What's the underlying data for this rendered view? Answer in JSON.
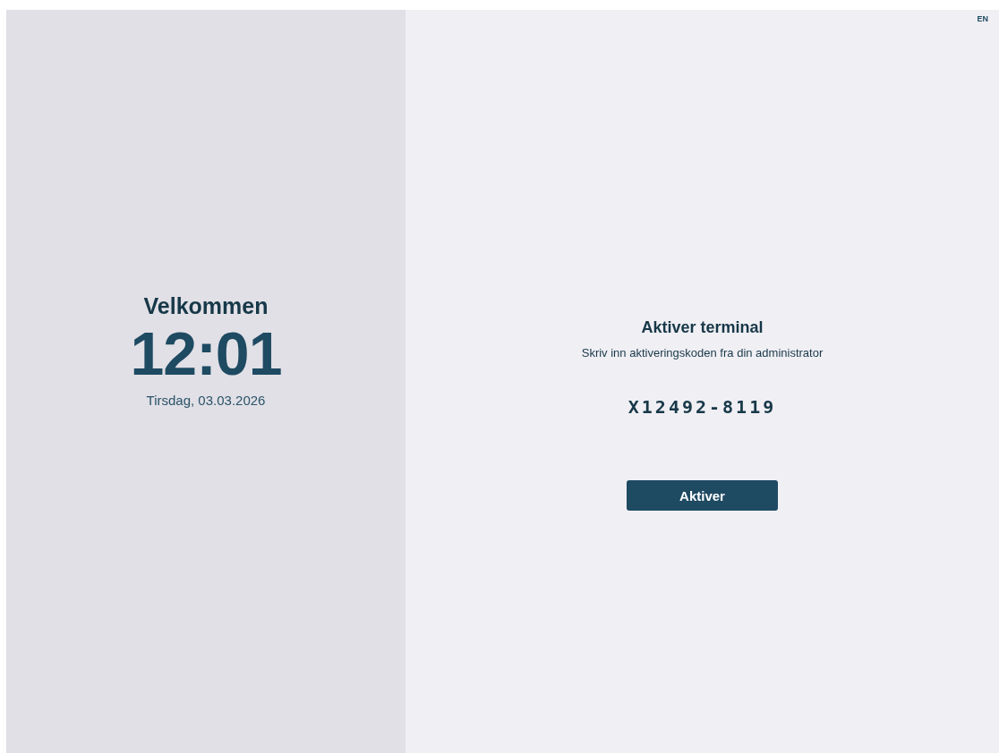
{
  "language_button": "EN",
  "welcome": {
    "title": "Velkommen",
    "time": "12:01",
    "date": "Tirsdag, 03.03.2026"
  },
  "activation": {
    "title": "Aktiver terminal",
    "instruction": "Skriv inn aktiveringskoden fra din administrator",
    "code": "X12492-8119",
    "button": "Aktiver"
  }
}
